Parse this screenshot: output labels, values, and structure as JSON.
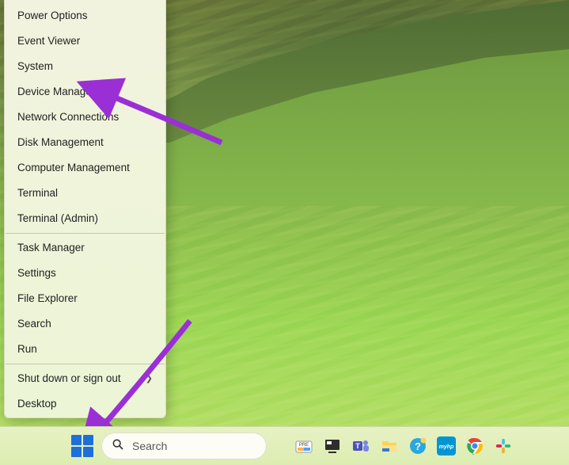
{
  "winx_menu": {
    "groups": [
      [
        {
          "label": "Power Options"
        },
        {
          "label": "Event Viewer"
        },
        {
          "label": "System"
        },
        {
          "label": "Device Manager"
        },
        {
          "label": "Network Connections"
        },
        {
          "label": "Disk Management"
        },
        {
          "label": "Computer Management"
        },
        {
          "label": "Terminal"
        },
        {
          "label": "Terminal (Admin)"
        }
      ],
      [
        {
          "label": "Task Manager"
        },
        {
          "label": "Settings"
        },
        {
          "label": "File Explorer"
        },
        {
          "label": "Search"
        },
        {
          "label": "Run"
        }
      ],
      [
        {
          "label": "Shut down or sign out",
          "submenu": true
        },
        {
          "label": "Desktop"
        }
      ]
    ]
  },
  "taskbar": {
    "search_placeholder": "Search",
    "pinned": [
      {
        "name": "dev-preview",
        "color1": "#ffb347",
        "color2": "#4aa3ff"
      },
      {
        "name": "task-view",
        "color1": "#2d2d2d",
        "color2": "#f5f5f5"
      },
      {
        "name": "teams",
        "color1": "#4b53bc",
        "color2": "#7b83eb"
      },
      {
        "name": "file-explorer",
        "color1": "#ffd257",
        "color2": "#2e7dd7"
      },
      {
        "name": "tips",
        "color1": "#2aa7e0",
        "color2": "#fff"
      },
      {
        "name": "myhp",
        "color1": "#0096d6",
        "color2": "#fff"
      },
      {
        "name": "chrome",
        "color1": "#ea4335",
        "color2": "#34a853"
      },
      {
        "name": "slack",
        "color1": "#e01e5a",
        "color2": "#36c5f0"
      }
    ]
  },
  "annotations": {
    "arrow_color": "#9a2fd6"
  }
}
